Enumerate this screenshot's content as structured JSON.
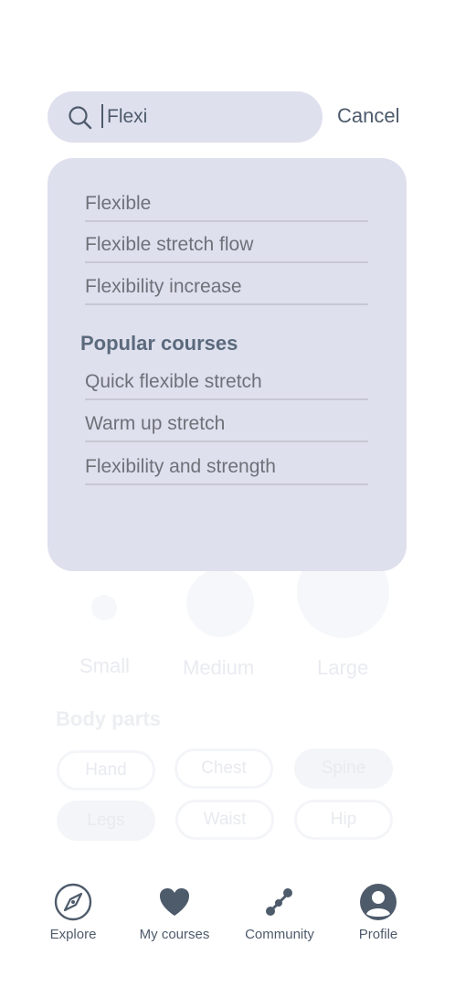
{
  "search": {
    "value": "Flexi",
    "cancel_label": "Cancel"
  },
  "suggestions": [
    "Flexible",
    "Flexible stretch flow",
    "Flexibility increase"
  ],
  "popular": {
    "title": "Popular courses",
    "items": [
      "Quick flexible stretch",
      "Warm up stretch",
      "Flexibility and strength"
    ]
  },
  "sizes": [
    "Small",
    "Medium",
    "Large"
  ],
  "body_parts": {
    "title": "Body parts",
    "chips": [
      "Hand",
      "Chest",
      "Spine",
      "Legs",
      "Waist",
      "Hip"
    ]
  },
  "nav": [
    {
      "label": "Explore",
      "icon": "compass-icon"
    },
    {
      "label": "My courses",
      "icon": "heart-icon"
    },
    {
      "label": "Community",
      "icon": "community-icon"
    },
    {
      "label": "Profile",
      "icon": "profile-icon"
    }
  ],
  "colors": {
    "panel_bg": "#dfe0ee",
    "accent_text": "#4e5b6b",
    "section_title": "#5b6a7c"
  }
}
